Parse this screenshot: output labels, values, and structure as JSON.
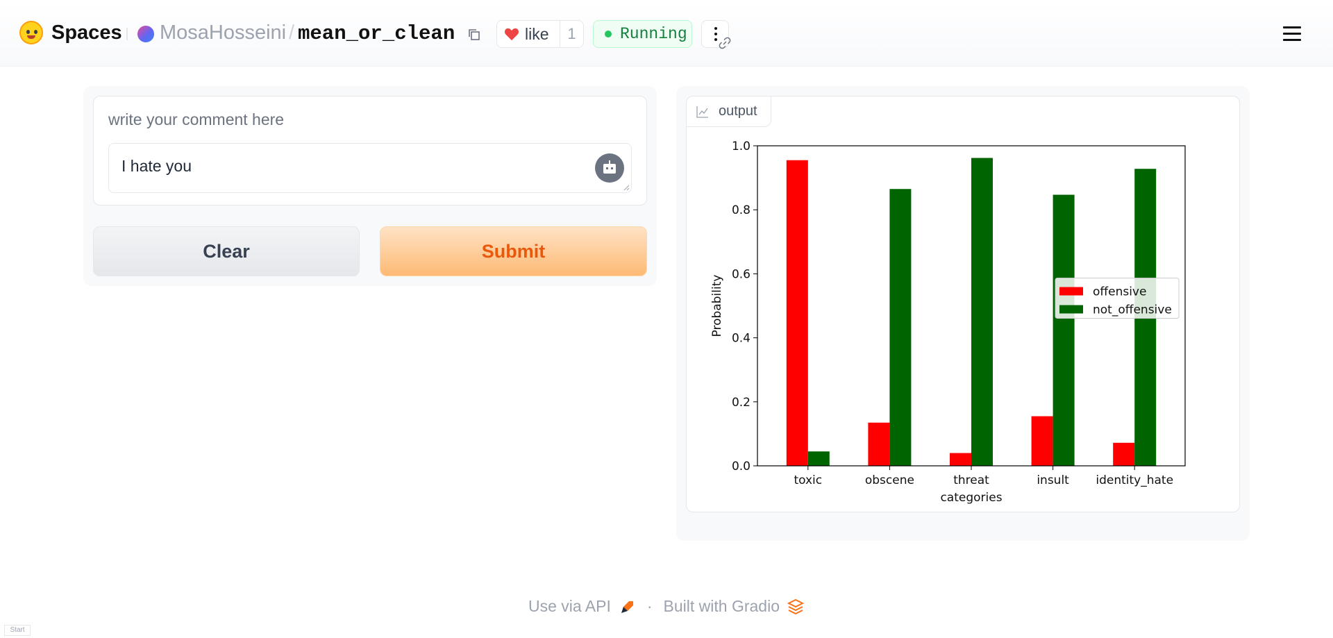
{
  "header": {
    "brand": "Spaces",
    "owner": "MosaHosseini",
    "separator": "/",
    "space_name": "mean_or_clean",
    "like_label": "like",
    "like_count": "1",
    "status": "Running",
    "icons": [
      "huggingface-logo",
      "copy-icon",
      "heart-icon",
      "more-vertical-icon",
      "link-icon",
      "hamburger-menu-icon"
    ]
  },
  "input": {
    "label": "write your comment here",
    "value": "I hate you"
  },
  "buttons": {
    "clear": "Clear",
    "submit": "Submit"
  },
  "output": {
    "label": "output"
  },
  "chart_data": {
    "type": "bar",
    "categories": [
      "toxic",
      "obscene",
      "threat",
      "insult",
      "identity_hate"
    ],
    "series": [
      {
        "name": "offensive",
        "color": "#ff0000",
        "values": [
          0.955,
          0.135,
          0.04,
          0.155,
          0.072
        ]
      },
      {
        "name": "not_offensive",
        "color": "#006400",
        "values": [
          0.045,
          0.865,
          0.962,
          0.847,
          0.928
        ]
      }
    ],
    "xlabel": "categories",
    "ylabel": "Probability",
    "ylim": [
      0,
      1.0
    ],
    "yticks": [
      "0.0",
      "0.2",
      "0.4",
      "0.6",
      "0.8",
      "1.0"
    ],
    "legend_position": "center-right",
    "grid": false
  },
  "footer": {
    "api": "Use via API",
    "separator": "·",
    "built_with": "Built with Gradio"
  },
  "corner_tag": "Start"
}
